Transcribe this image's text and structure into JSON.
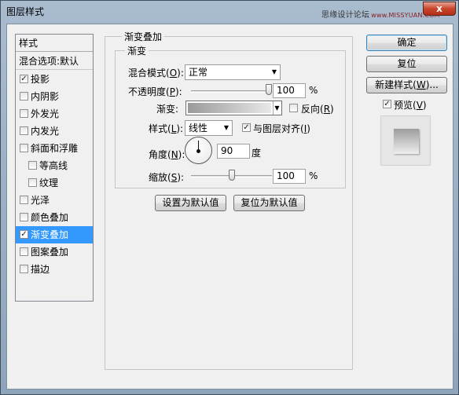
{
  "window": {
    "title": "图层样式",
    "watermark": "思缘设计论坛",
    "watermark_url": "www.MISSYUAN.COM",
    "close": "x"
  },
  "style_list": {
    "header": "样式",
    "blend_default": "混合选项:默认",
    "items": [
      {
        "label": "投影",
        "checked": true
      },
      {
        "label": "内阴影",
        "checked": false
      },
      {
        "label": "外发光",
        "checked": false
      },
      {
        "label": "内发光",
        "checked": false
      },
      {
        "label": "斜面和浮雕",
        "checked": false
      },
      {
        "label": "等高线",
        "checked": false
      },
      {
        "label": "纹理",
        "checked": false
      },
      {
        "label": "光泽",
        "checked": false
      },
      {
        "label": "颜色叠加",
        "checked": false
      },
      {
        "label": "渐变叠加",
        "checked": true
      },
      {
        "label": "图案叠加",
        "checked": false
      },
      {
        "label": "描边",
        "checked": false
      }
    ]
  },
  "panel": {
    "group_title": "渐变叠加",
    "sub_group_title": "渐变",
    "blend_mode_label": "混合模式(",
    "blend_mode_key": "O",
    "blend_mode_value": "正常",
    "opacity_label": "不透明度(",
    "opacity_key": "P",
    "opacity_value": "100",
    "opacity_percent": 100,
    "gradient_label": "渐变:",
    "reverse_label": "反向(",
    "reverse_key": "R",
    "reverse_checked": false,
    "style_label": "样式(",
    "style_key": "L",
    "style_value": "线性",
    "align_label": "与图层对齐(",
    "align_key": "I",
    "align_checked": true,
    "angle_label": "角度(",
    "angle_key": "N",
    "angle_value": "90",
    "angle_unit": "度",
    "scale_label": "缩放(",
    "scale_key": "S",
    "scale_value": "100",
    "scale_percent": 100,
    "percent_sign": "%",
    "make_default_button": "设置为默认值",
    "reset_default_button": "复位为默认值"
  },
  "actions": {
    "ok": "确定",
    "reset": "复位",
    "new_style": "新建样式(",
    "new_style_key": "W",
    "new_style_suffix": ")...",
    "preview_label": "预览(",
    "preview_key": "V",
    "preview_checked": true
  },
  "colors": {
    "selection": "#3399ff",
    "gradient_start": "#9a9a9a",
    "gradient_end": "#e8e8e8"
  }
}
